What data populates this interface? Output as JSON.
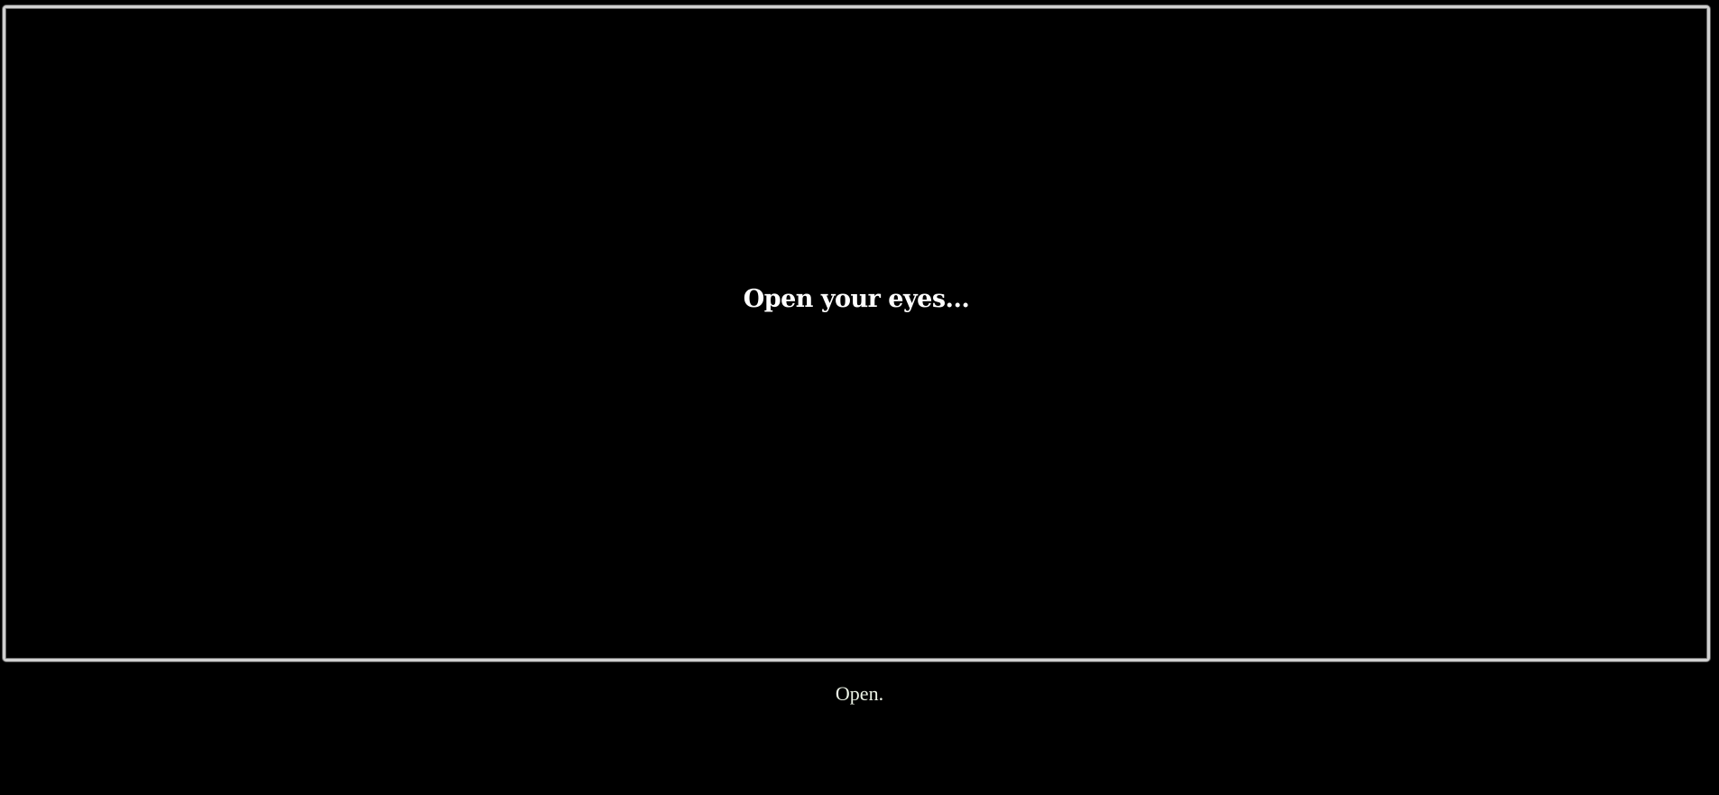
{
  "game": {
    "narration": "Open your eyes...",
    "choices": [
      {
        "label": "Open."
      }
    ]
  },
  "colors": {
    "background": "#000000",
    "frame_border": "#cfcfcf",
    "narration_text": "#ffffff",
    "choice_text": "#ecf3e6"
  }
}
